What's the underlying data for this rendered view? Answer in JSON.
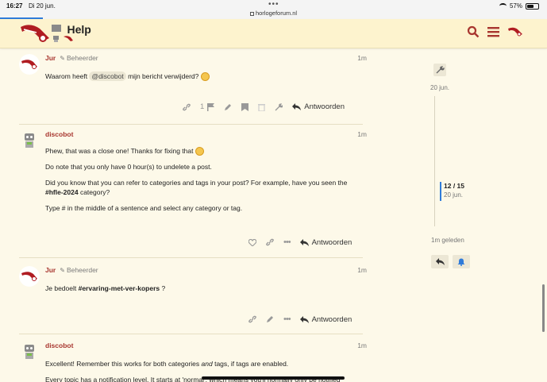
{
  "status": {
    "time": "16:27",
    "date": "Di 20 jun.",
    "url": "horlogeforum.nl",
    "battery": "57%"
  },
  "header": {
    "title": "Help"
  },
  "posts": [
    {
      "user": "Jur",
      "role": "Beheerder",
      "age": "1m",
      "text_before": "Waarom heeft ",
      "mention": "@discobot",
      "text_after": " mijn bericht verwijderd?",
      "like_count": "1",
      "reply": "Antwoorden"
    },
    {
      "user": "discobot",
      "age": "1m",
      "p1": "Phew, that was a close one! Thanks for fixing that",
      "p2": "Do note that you only have 0 hour(s) to undelete a post.",
      "p3a": "Did you know that you can refer to categories and tags in your post? For example, have you seen the",
      "p3b": "#hfle-2024",
      "p3c": " category?",
      "p4": "Type # in the middle of a sentence and select any category or tag.",
      "reply": "Antwoorden"
    },
    {
      "user": "Jur",
      "role": "Beheerder",
      "age": "1m",
      "text_before": "Je bedoelt ",
      "hashtag": "#ervaring-met-ver-kopers",
      "text_after": " ?",
      "reply": "Antwoorden"
    },
    {
      "user": "discobot",
      "age": "1m",
      "p1a": "Excellent! Remember this works for both categories ",
      "p1b": "and",
      "p1c": " tags, if tags are enabled.",
      "p2": "Every topic has a notification level. It starts at 'normal', which means you'll normally only be notified"
    }
  ],
  "timeline": {
    "top_date": "20 jun.",
    "position": "12 / 15",
    "position_date": "20 jun.",
    "bottom": "1m geleden"
  },
  "colors": {
    "accent": "#a8362f",
    "brand": "#b01c22",
    "link": "#2f7bd9",
    "background": "#fdf9e9"
  }
}
